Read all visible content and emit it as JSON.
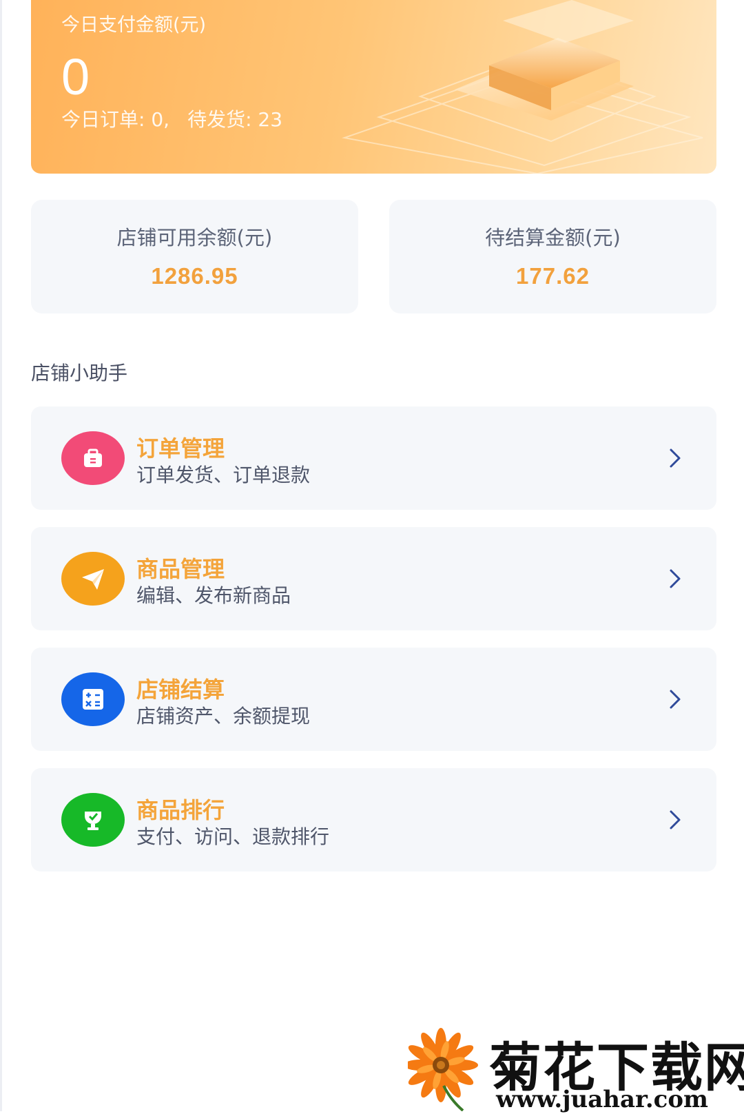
{
  "hero": {
    "label": "今日支付金额(元)",
    "amount": "0",
    "orders_text": "今日订单: 0,",
    "pending_text": "待发货: 23"
  },
  "stats": [
    {
      "label": "店铺可用余额(元)",
      "value": "1286.95"
    },
    {
      "label": "待结算金额(元)",
      "value": "177.62"
    }
  ],
  "helper": {
    "title": "店铺小助手",
    "items": [
      {
        "title": "订单管理",
        "desc": "订单发货、订单退款",
        "icon": "briefcase-icon",
        "color": "#f24b77"
      },
      {
        "title": "商品管理",
        "desc": "编辑、发布新商品",
        "icon": "paper-plane-icon",
        "color": "#f5a21c"
      },
      {
        "title": "店铺结算",
        "desc": "店铺资产、余额提现",
        "icon": "calculator-icon",
        "color": "#1566e8"
      },
      {
        "title": "商品排行",
        "desc": "支付、访问、退款排行",
        "icon": "trophy-icon",
        "color": "#17b928"
      }
    ]
  },
  "watermark": {
    "name": "菊花下载网",
    "url": "www.juahar.com"
  },
  "colors": {
    "accent": "#f4a43a",
    "card_bg": "#f5f7fa",
    "chevron": "#2f4a9a"
  }
}
